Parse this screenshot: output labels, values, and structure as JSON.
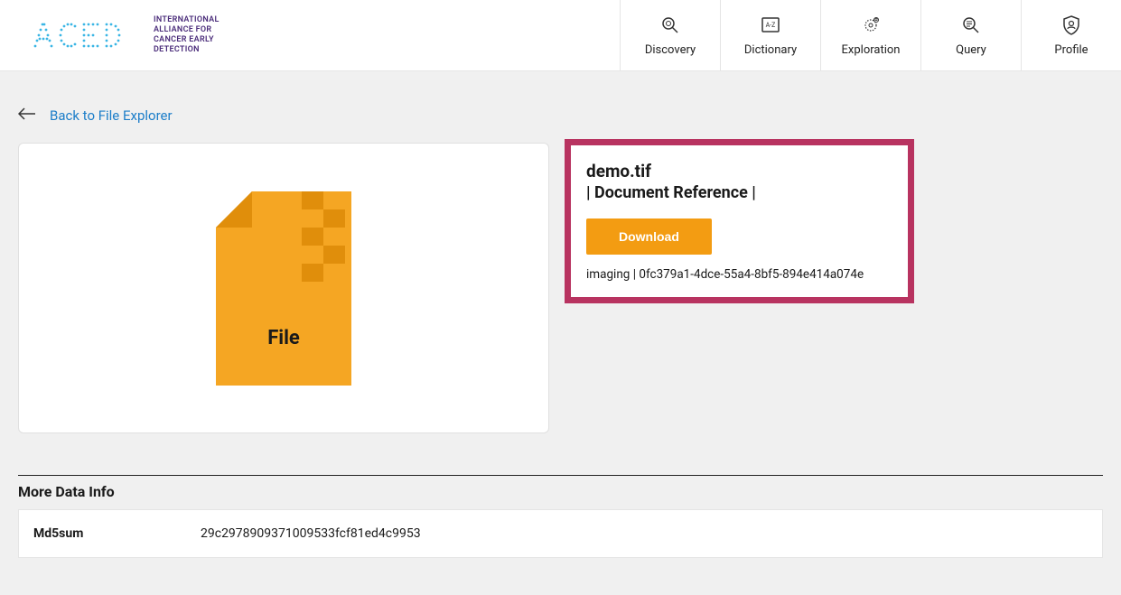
{
  "logo": {
    "main": "ACED",
    "sub_line1": "INTERNATIONAL",
    "sub_line2": "ALLIANCE FOR",
    "sub_line3": "CANCER EARLY",
    "sub_line4": "DETECTION"
  },
  "nav": {
    "discovery": "Discovery",
    "dictionary": "Dictionary",
    "exploration": "Exploration",
    "query": "Query",
    "profile": "Profile"
  },
  "back": {
    "label": "Back to File Explorer"
  },
  "preview": {
    "file_label": "File"
  },
  "info": {
    "filename": "demo.tif",
    "doc_ref": "| Document Reference |",
    "download_label": "Download",
    "category": "imaging",
    "guid": "0fc379a1-4dce-55a4-8bf5-894e414a074e"
  },
  "more_info": {
    "title": "More Data Info",
    "rows": [
      {
        "key": "Md5sum",
        "value": "29c2978909371009533fcf81ed4c9953"
      }
    ]
  }
}
